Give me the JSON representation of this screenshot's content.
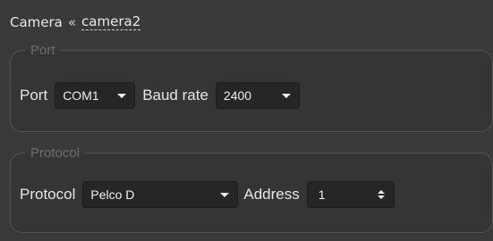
{
  "header": {
    "title": "Camera",
    "separator": "«",
    "camera_link": "camera2"
  },
  "port_group": {
    "legend": "Port",
    "port_label": "Port",
    "port_value": "COM1",
    "baud_label": "Baud rate",
    "baud_value": "2400"
  },
  "protocol_group": {
    "legend": "Protocol",
    "protocol_label": "Protocol",
    "protocol_value": "Pelco D",
    "address_label": "Address",
    "address_value": "1"
  },
  "colors": {
    "background": "#3a3a3a",
    "group_background": "#353535",
    "control_background": "#262626",
    "legend_text": "#6d6d6d",
    "text": "#e6e6e6"
  },
  "icons": [
    "chevron-down-icon",
    "spinner-arrows-icon"
  ]
}
